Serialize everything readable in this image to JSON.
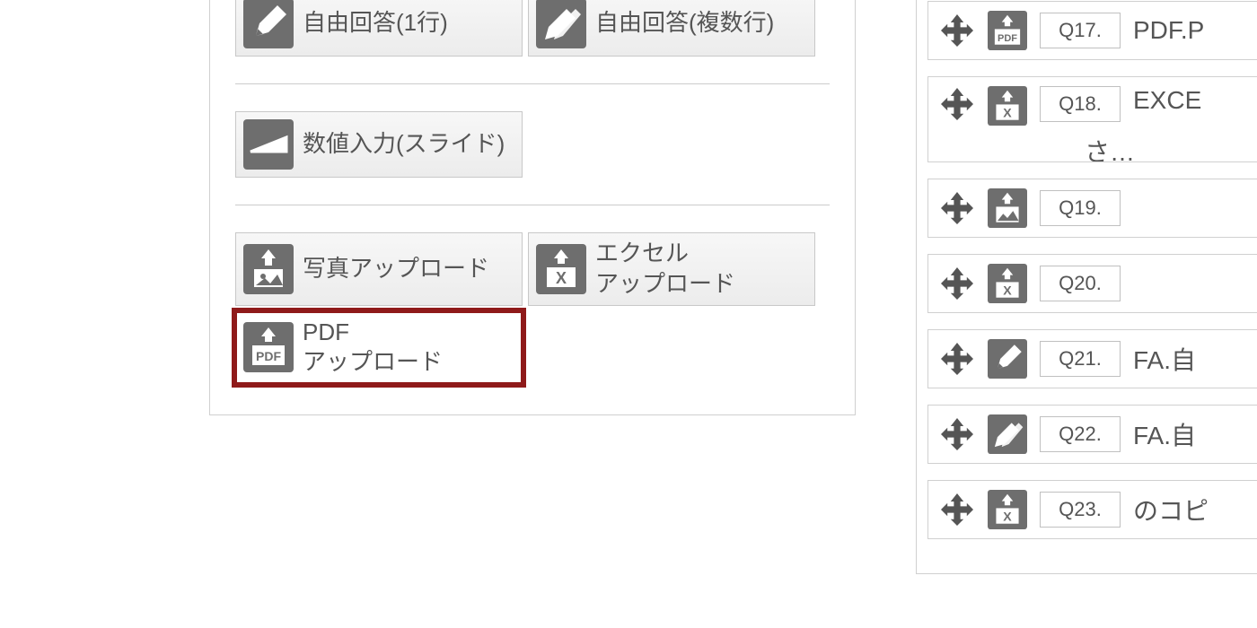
{
  "types": {
    "free1": "自由回答(1行)",
    "freeMulti": "自由回答(複数行)",
    "slider": "数値入力(スライド)",
    "photo": "写真アップロード",
    "excel": "エクセル\nアップロード",
    "pdf": "PDF\nアップロード"
  },
  "questions": [
    {
      "num": "Q17.",
      "text": "PDF.P",
      "icon": "pdf"
    },
    {
      "num": "Q18.",
      "text": "EXCE",
      "suffix": "さ…",
      "icon": "excel"
    },
    {
      "num": "Q19.",
      "text": "",
      "icon": "image"
    },
    {
      "num": "Q20.",
      "text": "",
      "icon": "excel"
    },
    {
      "num": "Q21.",
      "text": "FA.自",
      "icon": "pen"
    },
    {
      "num": "Q22.",
      "text": "FA.自",
      "icon": "pen2"
    },
    {
      "num": "Q23.",
      "text": "のコピ",
      "icon": "excel"
    }
  ]
}
